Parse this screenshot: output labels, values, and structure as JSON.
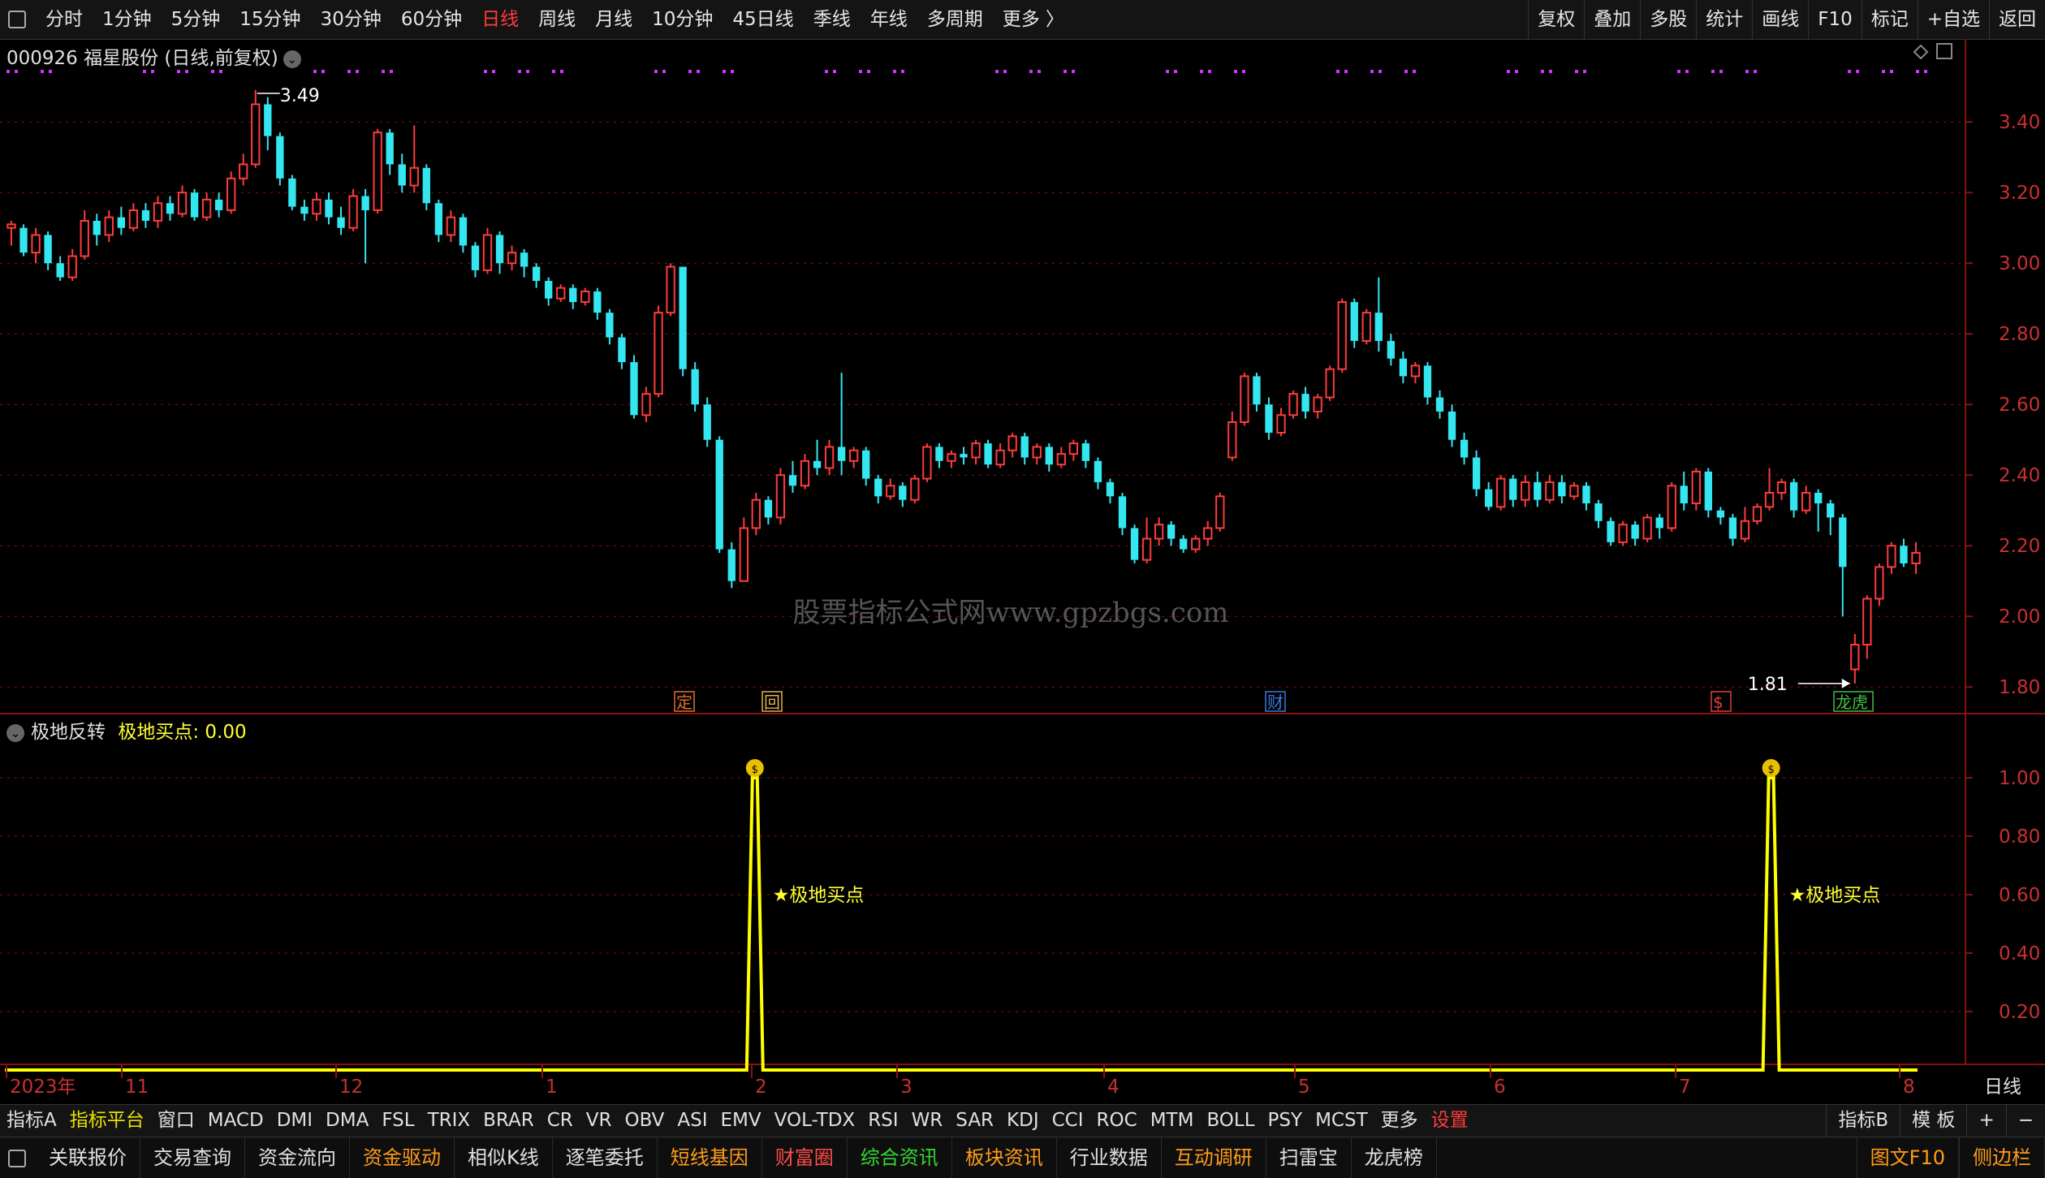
{
  "toolbar": {
    "periods": [
      "分时",
      "1分钟",
      "5分钟",
      "15分钟",
      "30分钟",
      "60分钟",
      "日线",
      "周线",
      "月线",
      "10分钟",
      "45日线",
      "季线",
      "年线",
      "多周期",
      "更多 〉"
    ],
    "active_index": 6,
    "right_buttons": [
      "复权",
      "叠加",
      "多股",
      "统计",
      "画线",
      "F10",
      "标记",
      "+自选",
      "返回"
    ]
  },
  "stock": {
    "title": "000926 福星股份 (日线,前复权)"
  },
  "main_chart": {
    "price_axis": [
      "3.40",
      "3.20",
      "3.00",
      "2.80",
      "2.60",
      "2.40",
      "2.20",
      "2.00",
      "1.80"
    ],
    "max_label": "3.49",
    "min_label": "1.81",
    "watermark": "股票指标公式网www.gpzbgs.com",
    "event_markers": [
      "定",
      "回",
      "财",
      "$",
      "龙虎"
    ]
  },
  "indicator": {
    "name": "极地反转",
    "value_label": "极地买点: 0.00",
    "axis": [
      "1.00",
      "0.80",
      "0.60",
      "0.40",
      "0.20"
    ],
    "signal_label": "★极地买点"
  },
  "time_axis": {
    "labels": [
      "2023年",
      "11",
      "12",
      "1",
      "2",
      "3",
      "4",
      "5",
      "6",
      "7",
      "8"
    ],
    "period": "日线"
  },
  "chart_data": {
    "type": "candlestick",
    "title": "000926 福星股份 (日线,前复权)",
    "ylim": [
      1.75,
      3.52
    ],
    "max": 3.49,
    "min": 1.81,
    "candles": [
      [
        3.1,
        3.11,
        3.05,
        3.12
      ],
      [
        3.1,
        3.03,
        3.02,
        3.11
      ],
      [
        3.03,
        3.08,
        3.0,
        3.1
      ],
      [
        3.08,
        3.0,
        2.98,
        3.09
      ],
      [
        3.0,
        2.96,
        2.95,
        3.02
      ],
      [
        2.96,
        3.02,
        2.95,
        3.04
      ],
      [
        3.02,
        3.12,
        3.01,
        3.15
      ],
      [
        3.12,
        3.08,
        3.05,
        3.14
      ],
      [
        3.08,
        3.13,
        3.06,
        3.15
      ],
      [
        3.13,
        3.1,
        3.08,
        3.16
      ],
      [
        3.1,
        3.15,
        3.09,
        3.17
      ],
      [
        3.15,
        3.12,
        3.1,
        3.17
      ],
      [
        3.12,
        3.17,
        3.1,
        3.19
      ],
      [
        3.17,
        3.14,
        3.12,
        3.19
      ],
      [
        3.14,
        3.2,
        3.13,
        3.22
      ],
      [
        3.2,
        3.13,
        3.12,
        3.21
      ],
      [
        3.13,
        3.18,
        3.12,
        3.2
      ],
      [
        3.18,
        3.15,
        3.13,
        3.2
      ],
      [
        3.15,
        3.24,
        3.14,
        3.26
      ],
      [
        3.24,
        3.28,
        3.22,
        3.31
      ],
      [
        3.28,
        3.45,
        3.27,
        3.49
      ],
      [
        3.45,
        3.36,
        3.32,
        3.47
      ],
      [
        3.36,
        3.24,
        3.22,
        3.37
      ],
      [
        3.24,
        3.16,
        3.15,
        3.25
      ],
      [
        3.16,
        3.14,
        3.12,
        3.18
      ],
      [
        3.14,
        3.18,
        3.12,
        3.2
      ],
      [
        3.18,
        3.13,
        3.11,
        3.2
      ],
      [
        3.13,
        3.1,
        3.08,
        3.16
      ],
      [
        3.1,
        3.19,
        3.09,
        3.21
      ],
      [
        3.19,
        3.15,
        3.0,
        3.21
      ],
      [
        3.15,
        3.37,
        3.14,
        3.38
      ],
      [
        3.37,
        3.28,
        3.25,
        3.38
      ],
      [
        3.28,
        3.22,
        3.2,
        3.31
      ],
      [
        3.22,
        3.27,
        3.2,
        3.39
      ],
      [
        3.27,
        3.17,
        3.15,
        3.28
      ],
      [
        3.17,
        3.08,
        3.06,
        3.18
      ],
      [
        3.08,
        3.13,
        3.06,
        3.15
      ],
      [
        3.13,
        3.05,
        3.03,
        3.14
      ],
      [
        3.05,
        2.98,
        2.96,
        3.06
      ],
      [
        2.98,
        3.08,
        2.97,
        3.1
      ],
      [
        3.08,
        3.0,
        2.97,
        3.09
      ],
      [
        3.0,
        3.03,
        2.98,
        3.05
      ],
      [
        3.03,
        2.99,
        2.96,
        3.04
      ],
      [
        2.99,
        2.95,
        2.93,
        3.0
      ],
      [
        2.95,
        2.9,
        2.88,
        2.96
      ],
      [
        2.9,
        2.93,
        2.89,
        2.94
      ],
      [
        2.93,
        2.89,
        2.87,
        2.94
      ],
      [
        2.89,
        2.92,
        2.88,
        2.93
      ],
      [
        2.92,
        2.86,
        2.84,
        2.93
      ],
      [
        2.86,
        2.79,
        2.77,
        2.87
      ],
      [
        2.79,
        2.72,
        2.7,
        2.8
      ],
      [
        2.72,
        2.57,
        2.56,
        2.74
      ],
      [
        2.57,
        2.63,
        2.55,
        2.65
      ],
      [
        2.63,
        2.86,
        2.62,
        2.88
      ],
      [
        2.86,
        2.99,
        2.85,
        3.0
      ],
      [
        2.99,
        2.7,
        2.68,
        2.99
      ],
      [
        2.7,
        2.6,
        2.58,
        2.72
      ],
      [
        2.6,
        2.5,
        2.48,
        2.62
      ],
      [
        2.5,
        2.19,
        2.18,
        2.51
      ],
      [
        2.19,
        2.1,
        2.08,
        2.21
      ],
      [
        2.1,
        2.25,
        2.1,
        2.28
      ],
      [
        2.25,
        2.33,
        2.23,
        2.35
      ],
      [
        2.33,
        2.28,
        2.26,
        2.34
      ],
      [
        2.28,
        2.4,
        2.26,
        2.42
      ],
      [
        2.4,
        2.37,
        2.35,
        2.44
      ],
      [
        2.37,
        2.44,
        2.36,
        2.46
      ],
      [
        2.44,
        2.42,
        2.4,
        2.5
      ],
      [
        2.42,
        2.48,
        2.4,
        2.5
      ],
      [
        2.48,
        2.44,
        2.4,
        2.69
      ],
      [
        2.44,
        2.47,
        2.42,
        2.48
      ],
      [
        2.47,
        2.39,
        2.37,
        2.48
      ],
      [
        2.39,
        2.34,
        2.32,
        2.4
      ],
      [
        2.34,
        2.37,
        2.33,
        2.39
      ],
      [
        2.37,
        2.33,
        2.31,
        2.38
      ],
      [
        2.33,
        2.39,
        2.32,
        2.4
      ],
      [
        2.39,
        2.48,
        2.38,
        2.49
      ],
      [
        2.48,
        2.44,
        2.42,
        2.49
      ],
      [
        2.44,
        2.46,
        2.42,
        2.47
      ],
      [
        2.46,
        2.45,
        2.43,
        2.48
      ],
      [
        2.45,
        2.49,
        2.43,
        2.5
      ],
      [
        2.49,
        2.43,
        2.42,
        2.5
      ],
      [
        2.43,
        2.47,
        2.42,
        2.49
      ],
      [
        2.47,
        2.51,
        2.45,
        2.52
      ],
      [
        2.51,
        2.45,
        2.43,
        2.52
      ],
      [
        2.45,
        2.48,
        2.43,
        2.49
      ],
      [
        2.48,
        2.43,
        2.41,
        2.49
      ],
      [
        2.43,
        2.46,
        2.42,
        2.48
      ],
      [
        2.46,
        2.49,
        2.44,
        2.5
      ],
      [
        2.49,
        2.44,
        2.42,
        2.5
      ],
      [
        2.44,
        2.38,
        2.36,
        2.45
      ],
      [
        2.38,
        2.34,
        2.32,
        2.39
      ],
      [
        2.34,
        2.25,
        2.23,
        2.35
      ],
      [
        2.25,
        2.16,
        2.15,
        2.26
      ],
      [
        2.16,
        2.22,
        2.15,
        2.28
      ],
      [
        2.22,
        2.26,
        2.2,
        2.28
      ],
      [
        2.26,
        2.22,
        2.2,
        2.27
      ],
      [
        2.22,
        2.19,
        2.18,
        2.23
      ],
      [
        2.19,
        2.22,
        2.18,
        2.23
      ],
      [
        2.22,
        2.25,
        2.2,
        2.27
      ],
      [
        2.25,
        2.34,
        2.24,
        2.35
      ],
      [
        2.45,
        2.55,
        2.44,
        2.58
      ],
      [
        2.55,
        2.68,
        2.54,
        2.69
      ],
      [
        2.68,
        2.6,
        2.58,
        2.69
      ],
      [
        2.6,
        2.52,
        2.5,
        2.62
      ],
      [
        2.52,
        2.57,
        2.51,
        2.59
      ],
      [
        2.57,
        2.63,
        2.56,
        2.64
      ],
      [
        2.63,
        2.58,
        2.56,
        2.65
      ],
      [
        2.58,
        2.62,
        2.56,
        2.63
      ],
      [
        2.62,
        2.7,
        2.61,
        2.71
      ],
      [
        2.7,
        2.89,
        2.69,
        2.9
      ],
      [
        2.89,
        2.78,
        2.76,
        2.9
      ],
      [
        2.78,
        2.86,
        2.77,
        2.87
      ],
      [
        2.86,
        2.78,
        2.75,
        2.96
      ],
      [
        2.78,
        2.73,
        2.71,
        2.8
      ],
      [
        2.73,
        2.68,
        2.66,
        2.75
      ],
      [
        2.68,
        2.71,
        2.66,
        2.72
      ],
      [
        2.71,
        2.62,
        2.6,
        2.72
      ],
      [
        2.62,
        2.58,
        2.56,
        2.64
      ],
      [
        2.58,
        2.5,
        2.48,
        2.6
      ],
      [
        2.5,
        2.45,
        2.43,
        2.52
      ],
      [
        2.45,
        2.36,
        2.34,
        2.47
      ],
      [
        2.36,
        2.31,
        2.3,
        2.38
      ],
      [
        2.31,
        2.39,
        2.3,
        2.4
      ],
      [
        2.39,
        2.33,
        2.31,
        2.4
      ],
      [
        2.33,
        2.38,
        2.31,
        2.4
      ],
      [
        2.38,
        2.33,
        2.31,
        2.41
      ],
      [
        2.33,
        2.38,
        2.32,
        2.4
      ],
      [
        2.38,
        2.34,
        2.32,
        2.4
      ],
      [
        2.34,
        2.37,
        2.33,
        2.38
      ],
      [
        2.37,
        2.32,
        2.3,
        2.38
      ],
      [
        2.32,
        2.27,
        2.25,
        2.33
      ],
      [
        2.27,
        2.21,
        2.2,
        2.28
      ],
      [
        2.21,
        2.26,
        2.2,
        2.27
      ],
      [
        2.26,
        2.22,
        2.2,
        2.27
      ],
      [
        2.22,
        2.28,
        2.21,
        2.29
      ],
      [
        2.28,
        2.25,
        2.22,
        2.29
      ],
      [
        2.25,
        2.37,
        2.24,
        2.38
      ],
      [
        2.37,
        2.32,
        2.3,
        2.41
      ],
      [
        2.32,
        2.41,
        2.3,
        2.42
      ],
      [
        2.41,
        2.3,
        2.28,
        2.42
      ],
      [
        2.3,
        2.28,
        2.26,
        2.31
      ],
      [
        2.28,
        2.22,
        2.2,
        2.29
      ],
      [
        2.22,
        2.27,
        2.21,
        2.31
      ],
      [
        2.27,
        2.31,
        2.26,
        2.32
      ],
      [
        2.31,
        2.35,
        2.3,
        2.42
      ],
      [
        2.35,
        2.38,
        2.33,
        2.39
      ],
      [
        2.38,
        2.3,
        2.28,
        2.39
      ],
      [
        2.3,
        2.35,
        2.29,
        2.37
      ],
      [
        2.35,
        2.32,
        2.24,
        2.36
      ],
      [
        2.32,
        2.28,
        2.23,
        2.33
      ],
      [
        2.28,
        2.14,
        2.0,
        2.29
      ],
      [
        1.85,
        1.92,
        1.81,
        1.95
      ],
      [
        1.92,
        2.05,
        1.88,
        2.06
      ],
      [
        2.05,
        2.14,
        2.03,
        2.15
      ],
      [
        2.14,
        2.2,
        2.12,
        2.21
      ],
      [
        2.2,
        2.15,
        2.14,
        2.22
      ],
      [
        2.15,
        2.18,
        2.12,
        2.21
      ]
    ],
    "indicator_series": {
      "name": "极地买点",
      "ylim": [
        0,
        1.05
      ],
      "signal_bar_indices": [
        150,
        150
      ],
      "signal_positions": [
        0.383,
        0.902
      ]
    }
  },
  "bottom_bar": {
    "items": [
      "指标A",
      "指标平台",
      "窗口",
      "MACD",
      "DMI",
      "DMA",
      "FSL",
      "TRIX",
      "BRAR",
      "CR",
      "VR",
      "OBV",
      "ASI",
      "EMV",
      "VOL-TDX",
      "RSI",
      "WR",
      "SAR",
      "KDJ",
      "CCI",
      "ROC",
      "MTM",
      "BOLL",
      "PSY",
      "MCST",
      "更多",
      "设置"
    ],
    "right": [
      "指标B",
      "模 板",
      "+",
      "−"
    ]
  },
  "function_bar": {
    "items": [
      "关联报价",
      "交易查询",
      "资金流向",
      "资金驱动",
      "相似K线",
      "逐笔委托",
      "短线基因",
      "财富圈",
      "综合资讯",
      "板块资讯",
      "行业数据",
      "互动调研",
      "扫雷宝",
      "龙虎榜"
    ],
    "right": [
      "图文F10",
      "侧边栏"
    ]
  },
  "colors": {
    "up": "#ff3b3b",
    "down": "#33e6f0",
    "signal": "#ffff00",
    "grid": "#8a1010",
    "magenta_dots": "#d633ff"
  }
}
